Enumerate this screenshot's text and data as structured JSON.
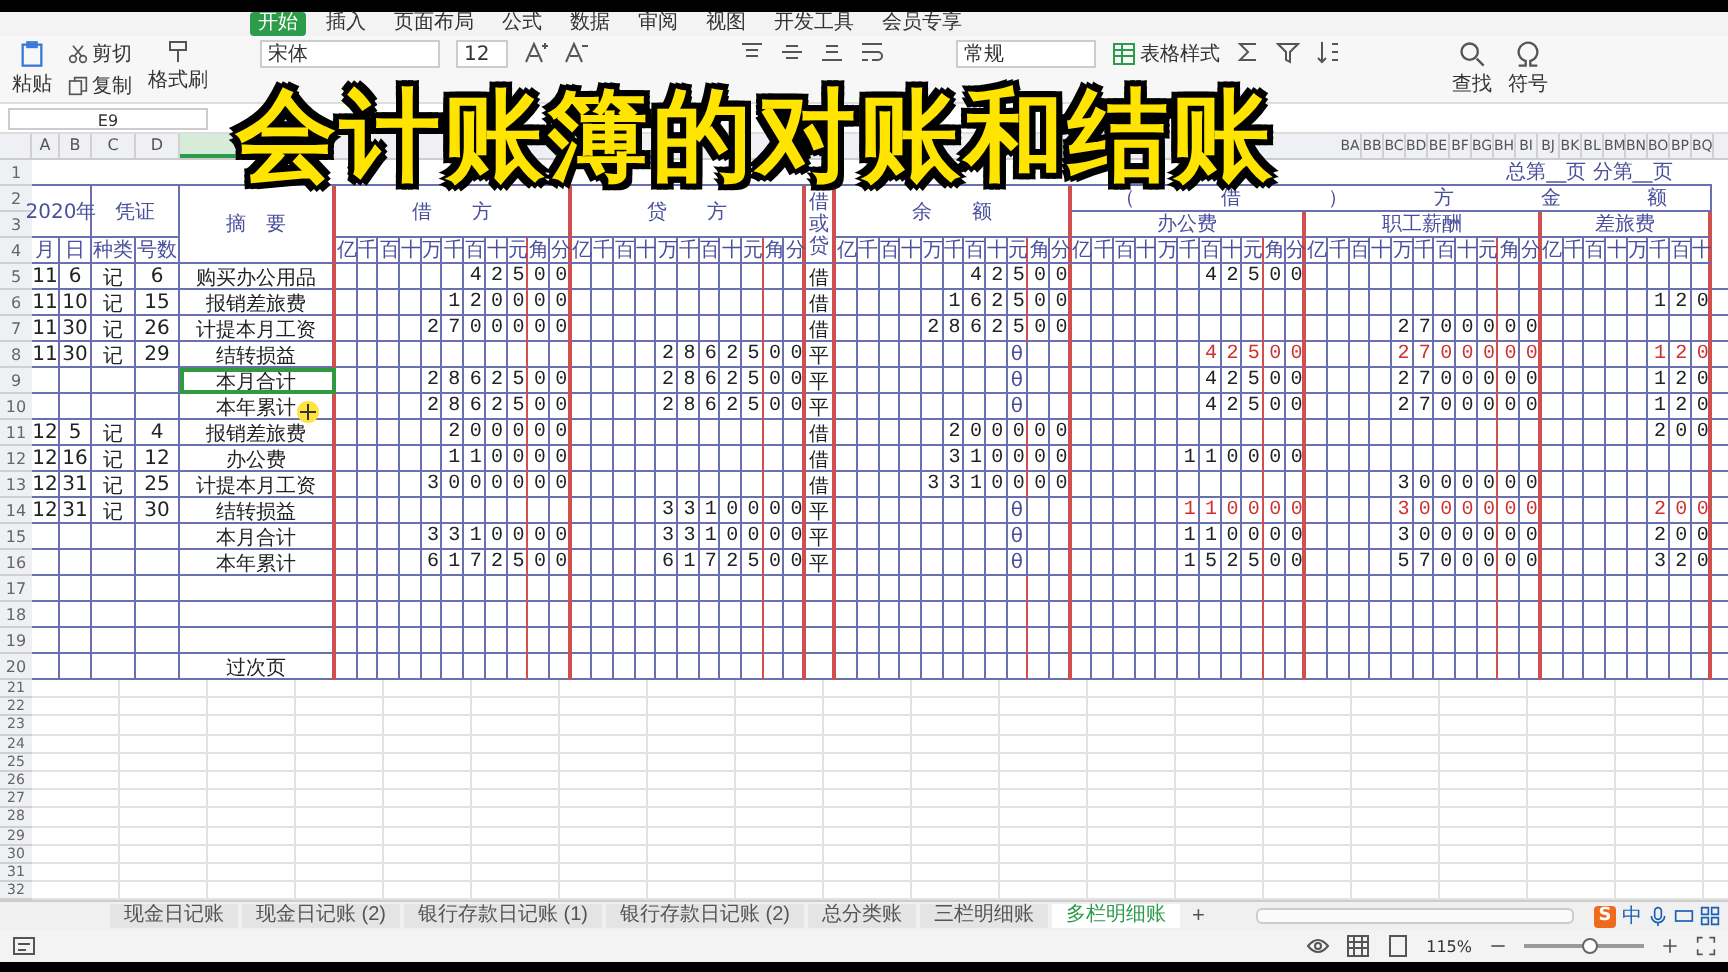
{
  "menu_tabs": [
    {
      "label": "开始",
      "selected": true
    },
    {
      "label": "插入",
      "selected": false
    },
    {
      "label": "页面布局",
      "selected": false
    },
    {
      "label": "公式",
      "selected": false
    },
    {
      "label": "数据",
      "selected": false
    },
    {
      "label": "审阅",
      "selected": false
    },
    {
      "label": "视图",
      "selected": false
    },
    {
      "label": "开发工具",
      "selected": false
    },
    {
      "label": "会员专享",
      "selected": false
    }
  ],
  "ribbon": {
    "paste": "粘贴",
    "cut": "剪切",
    "copy": "复制",
    "format_painter": "格式刷",
    "font": "宋体",
    "font_size": "12",
    "number_format": "常规",
    "table_style": "表格样式",
    "find": "查找",
    "symbol": "符号"
  },
  "name_box": "E9",
  "column_letters_left": [
    "A",
    "B",
    "C",
    "D"
  ],
  "column_letters_right": [
    "BA",
    "BB",
    "BC",
    "BD",
    "BE",
    "BF",
    "BG",
    "BH",
    "BI",
    "BJ",
    "BK",
    "BL",
    "BM",
    "BN",
    "BO",
    "BP",
    "BQ"
  ],
  "row_numbers": [
    "1",
    "2",
    "3",
    "4",
    "5",
    "6",
    "7",
    "8",
    "9",
    "10",
    "11",
    "12",
    "13",
    "14",
    "15",
    "16",
    "17",
    "18",
    "19",
    "20",
    "21",
    "22",
    "23",
    "24",
    "25",
    "26",
    "27",
    "28",
    "29",
    "30",
    "31",
    "32"
  ],
  "ledger": {
    "page_info": "总第__页  分第__页",
    "year": "2020年",
    "voucher": "凭证",
    "summary_header": "摘　要",
    "month_header": "月",
    "day_header": "日",
    "type_header": "种类",
    "number_header": "号数",
    "direction_header": "借或贷",
    "debit": {
      "title": "借　　方",
      "digit_headers": "亿千百十万千百十元角分"
    },
    "credit": {
      "title": "贷　　方",
      "digit_headers": "亿千百十万千百十元角分"
    },
    "balance": {
      "title": "余　　额",
      "digit_headers": "亿千百十万千百十元角分"
    },
    "analysis_title": "（ 借 ） 方 金 额",
    "analysis_groups": [
      {
        "title": "办公费",
        "digit_headers": "亿千百十万千百十元角分"
      },
      {
        "title": "职工薪酬",
        "digit_headers": "亿千百十万千百十元角分"
      },
      {
        "title": "差旅费",
        "digit_headers": "亿千百十万千百十"
      }
    ],
    "rows": [
      {
        "month": "11",
        "day": "6",
        "voucher_type": "记",
        "voucher_no": "6",
        "summary": "购买办公用品",
        "debit": "4 2 5 0 0",
        "direction": "借",
        "balance": "4 2 5 0 0",
        "analysis": {
          "office": "4 2 5 0 0"
        },
        "red_entry": false,
        "summary_selected": false
      },
      {
        "month": "11",
        "day": "10",
        "voucher_type": "记",
        "voucher_no": "15",
        "summary": "报销差旅费",
        "debit": "1 2 0 0 0 0",
        "direction": "借",
        "balance": "1 6 2 5 0 0",
        "analysis": {
          "travel": "1 2 0"
        },
        "red_entry": false,
        "summary_selected": false
      },
      {
        "month": "11",
        "day": "30",
        "voucher_type": "记",
        "voucher_no": "26",
        "summary": "计提本月工资",
        "debit": "2 7 0 0 0 0 0",
        "direction": "借",
        "balance": "2 8 6 2 5 0 0",
        "analysis": {
          "salary": "2 7 0 0 0 0 0"
        },
        "red_entry": false,
        "summary_selected": false
      },
      {
        "month": "11",
        "day": "30",
        "voucher_type": "记",
        "voucher_no": "29",
        "summary": "结转损益",
        "credit": "2 8 6 2 5 0 0",
        "direction": "平",
        "balance_mark": "θ",
        "analysis": {
          "office": "4 2 5 0 0",
          "salary": "2 7 0 0 0 0 0",
          "travel": "1 2 0"
        },
        "red_entry": true,
        "summary_selected": false
      },
      {
        "summary": "本月合计",
        "debit": "2 8 6 2 5 0 0",
        "credit": "2 8 6 2 5 0 0",
        "direction": "平",
        "balance_mark": "θ",
        "analysis": {
          "office": "4 2 5 0 0",
          "salary": "2 7 0 0 0 0 0",
          "travel": "1 2 0"
        },
        "red_entry": false,
        "summary_selected": true
      },
      {
        "summary": "本年累计",
        "debit": "2 8 6 2 5 0 0",
        "credit": "2 8 6 2 5 0 0",
        "direction": "平",
        "balance_mark": "θ",
        "analysis": {
          "office": "4 2 5 0 0",
          "salary": "2 7 0 0 0 0 0",
          "travel": "1 2 0"
        },
        "red_entry": false,
        "summary_selected": false
      },
      {
        "month": "12",
        "day": "5",
        "voucher_type": "记",
        "voucher_no": "4",
        "summary": "报销差旅费",
        "debit": "2 0 0 0 0 0",
        "direction": "借",
        "balance": "2 0 0 0 0 0",
        "analysis": {
          "travel": "2 0 0"
        },
        "red_entry": false,
        "summary_selected": false
      },
      {
        "month": "12",
        "day": "16",
        "voucher_type": "记",
        "voucher_no": "12",
        "summary": "办公费",
        "debit": "1 1 0 0 0 0",
        "direction": "借",
        "balance": "3 1 0 0 0 0",
        "analysis": {
          "office": "1 1 0 0 0 0"
        },
        "red_entry": false,
        "summary_selected": false
      },
      {
        "month": "12",
        "day": "31",
        "voucher_type": "记",
        "voucher_no": "25",
        "summary": "计提本月工资",
        "debit": "3 0 0 0 0 0 0",
        "direction": "借",
        "balance": "3 3 1 0 0 0 0",
        "analysis": {
          "salary": "3 0 0 0 0 0 0"
        },
        "red_entry": false,
        "summary_selected": false
      },
      {
        "month": "12",
        "day": "31",
        "voucher_type": "记",
        "voucher_no": "30",
        "summary": "结转损益",
        "credit": "3 3 1 0 0 0 0",
        "direction": "平",
        "balance_mark": "θ",
        "analysis": {
          "office": "1 1 0 0 0 0",
          "salary": "3 0 0 0 0 0 0",
          "travel": "2 0 0"
        },
        "red_entry": true,
        "summary_selected": false
      },
      {
        "summary": "本月合计",
        "debit": "3 3 1 0 0 0 0",
        "credit": "3 3 1 0 0 0 0",
        "direction": "平",
        "balance_mark": "θ",
        "analysis": {
          "office": "1 1 0 0 0 0",
          "salary": "3 0 0 0 0 0 0",
          "travel": "2 0 0"
        },
        "red_entry": false,
        "summary_selected": false
      },
      {
        "summary": "本年累计",
        "debit": "6 1 7 2 5 0 0",
        "credit": "6 1 7 2 5 0 0",
        "direction": "平",
        "balance_mark": "θ",
        "analysis": {
          "office": "1 5 2 5 0 0",
          "salary": "5 7 0 0 0 0 0",
          "travel": "3 2 0"
        },
        "red_entry": false,
        "summary_selected": false
      },
      {
        "summary_selected": false
      },
      {
        "summary_selected": false
      },
      {
        "summary_selected": false
      },
      {
        "summary": "过次页",
        "summary_selected": false
      }
    ]
  },
  "sheet_tabs": [
    {
      "label": "现金日记账",
      "selected": false
    },
    {
      "label": "现金日记账 (2)",
      "selected": false
    },
    {
      "label": "银行存款日记账 (1)",
      "selected": false
    },
    {
      "label": "银行存款日记账 (2)",
      "selected": false
    },
    {
      "label": "总分类账",
      "selected": false
    },
    {
      "label": "三栏明细账",
      "selected": false
    },
    {
      "label": "多栏明细账",
      "selected": true
    }
  ],
  "add_sheet": "+",
  "ime": {
    "logo": "S",
    "mode": "中"
  },
  "status": {
    "zoom": "115%",
    "zoom_slider": {
      "level": 0.55
    }
  },
  "overlay_title": "会计账簿的对账和结账"
}
